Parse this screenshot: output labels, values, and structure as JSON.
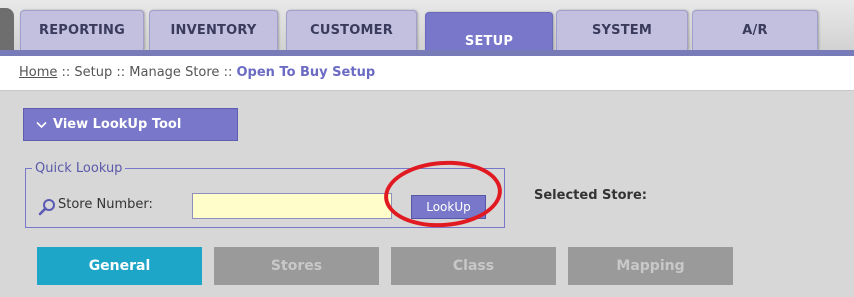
{
  "nav": {
    "tabs": [
      {
        "label": "REPORTING"
      },
      {
        "label": "INVENTORY"
      },
      {
        "label": "CUSTOMER"
      },
      {
        "label": "SETUP"
      },
      {
        "label": "SYSTEM"
      },
      {
        "label": "A/R"
      }
    ],
    "active_tab": "SETUP"
  },
  "breadcrumb": {
    "home": "Home",
    "sep": " :: ",
    "items": [
      "Setup",
      "Manage Store"
    ],
    "current": "Open To Buy Setup"
  },
  "lookup_tool": {
    "toggle_label": "View LookUp Tool",
    "icon": "chevron-down-icon"
  },
  "quick_lookup": {
    "legend": "Quick Lookup",
    "icon": "search-icon",
    "store_number_label": "Store Number:",
    "store_number_value": "",
    "button_label": "LookUp"
  },
  "selected_store": {
    "label": "Selected Store:",
    "value": ""
  },
  "subtabs": [
    {
      "label": "General",
      "active": true
    },
    {
      "label": "Stores",
      "active": false
    },
    {
      "label": "Class",
      "active": false
    },
    {
      "label": "Mapping",
      "active": false
    }
  ],
  "colors": {
    "accent": "#7877c9",
    "active_subtab": "#1ea6c8",
    "annotation": "#e11a22",
    "input_bg": "#fffeca"
  }
}
